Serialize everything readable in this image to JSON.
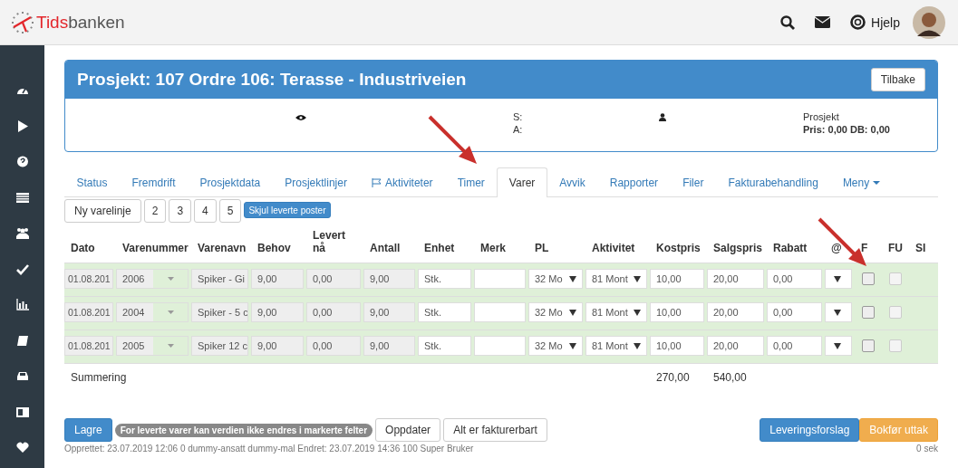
{
  "topbar": {
    "logo_part1": "Tids",
    "logo_part2": "banken",
    "help": "Hjelp"
  },
  "project": {
    "title": "Prosjekt: 107 Ordre 106: Terasse - Industriveien",
    "back_button": "Tilbake",
    "s_label": "S:",
    "a_label": "A:",
    "type": "Prosjekt",
    "price_line": "Pris: 0,00 DB: 0,00"
  },
  "tabs": [
    {
      "label": "Status",
      "kind": "plain",
      "selected": false
    },
    {
      "label": "Fremdrift",
      "kind": "plain",
      "selected": false
    },
    {
      "label": "Prosjektdata",
      "kind": "plain",
      "selected": false
    },
    {
      "label": "Prosjektlinjer",
      "kind": "plain",
      "selected": false
    },
    {
      "label": "Aktiviteter",
      "kind": "flag",
      "selected": false
    },
    {
      "label": "Timer",
      "kind": "plain",
      "selected": false
    },
    {
      "label": "Varer",
      "kind": "plain",
      "selected": true
    },
    {
      "label": "Avvik",
      "kind": "plain",
      "selected": false
    },
    {
      "label": "Rapporter",
      "kind": "plain",
      "selected": false
    },
    {
      "label": "Filer",
      "kind": "plain",
      "selected": false
    },
    {
      "label": "Fakturabehandling",
      "kind": "plain",
      "selected": false
    },
    {
      "label": "Meny",
      "kind": "dropdown",
      "selected": false
    }
  ],
  "toolbar": {
    "new_line": "Ny varelinje",
    "pages": [
      "2",
      "3",
      "4",
      "5"
    ],
    "hide_delivered": "Skjul leverte poster"
  },
  "table": {
    "columns": [
      "Dato",
      "Varenummer",
      "Varenavn",
      "Behov",
      "Levert nå",
      "Antall",
      "Enhet",
      "Merk",
      "PL",
      "Aktivitet",
      "Kostpris",
      "Salgspris",
      "Rabatt",
      "@",
      "F",
      "FU",
      "SI"
    ],
    "rows": [
      {
        "dato": "01.08.201",
        "varenummer": "2006",
        "varenavn": "Spiker - Gi",
        "behov": "9,00",
        "levert_naa": "0,00",
        "antall": "9,00",
        "enhet": "Stk.",
        "pl": "32 Mo",
        "aktivitet": "81 Mont",
        "kostpris": "10,00",
        "salgspris": "20,00",
        "rabatt": "0,00",
        "f_checked": false,
        "fu_checked": false,
        "fu_disabled": true
      },
      {
        "dato": "01.08.201",
        "varenummer": "2004",
        "varenavn": "Spiker - 5 c",
        "behov": "9,00",
        "levert_naa": "0,00",
        "antall": "9,00",
        "enhet": "Stk.",
        "pl": "32 Mo",
        "aktivitet": "81 Mont",
        "kostpris": "10,00",
        "salgspris": "20,00",
        "rabatt": "0,00",
        "f_checked": false,
        "fu_checked": false,
        "fu_disabled": true
      },
      {
        "dato": "01.08.201",
        "varenummer": "2005",
        "varenavn": "Spiker 12 c",
        "behov": "9,00",
        "levert_naa": "0,00",
        "antall": "9,00",
        "enhet": "Stk.",
        "pl": "32 Mo",
        "aktivitet": "81 Mont",
        "kostpris": "10,00",
        "salgspris": "20,00",
        "rabatt": "0,00",
        "f_checked": false,
        "fu_checked": false,
        "fu_disabled": true
      }
    ],
    "summary": {
      "label": "Summering",
      "kostpris": "270,00",
      "salgspris": "540,00"
    }
  },
  "footer": {
    "save": "Lagre",
    "note": "For leverte varer kan verdien ikke endres i markerte felter",
    "update": "Oppdater",
    "all_billable": "Alt er fakturerbart",
    "delivery": "Leveringsforslag",
    "post": "Bokfør uttak",
    "meta": "Opprettet: 23.07.2019 12:06 0 dummy-ansatt dummy-mal Endret: 23.07.2019 14:36 100 Super Bruker",
    "timing": "0 sek"
  }
}
